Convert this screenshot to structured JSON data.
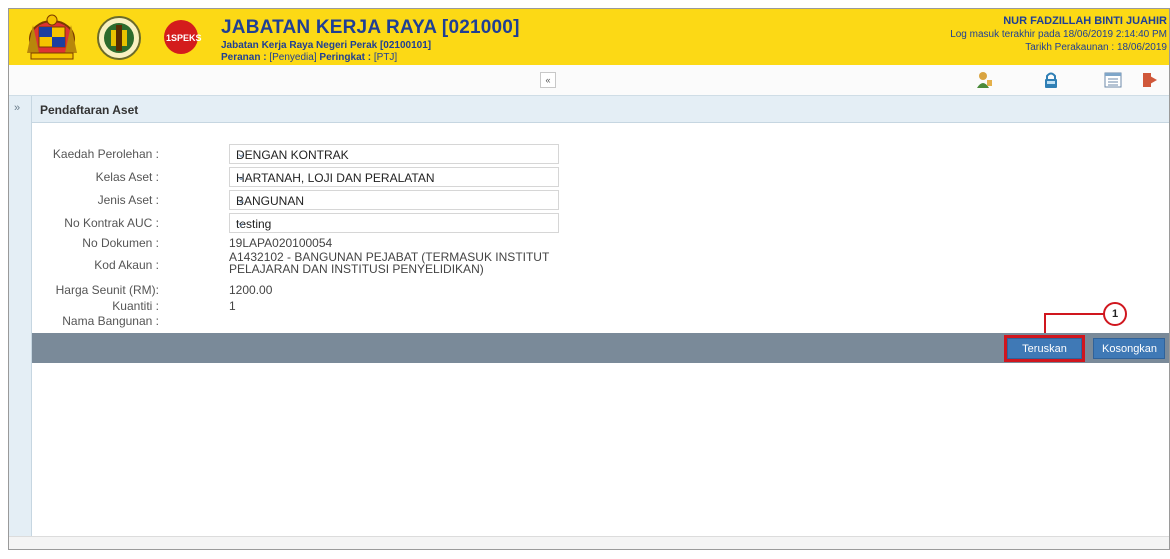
{
  "header": {
    "title": "JABATAN KERJA RAYA [021000]",
    "subtitle": "Jabatan Kerja Raya Negeri Perak [02100101]",
    "role_label": "Peranan :",
    "role_value": "[Penyedia]",
    "level_label": "Peringkat :",
    "level_value": "[PTJ]",
    "logo_text": "1SPEKS",
    "user_name": "NUR FADZILLAH BINTI JUAHIR",
    "last_login": "Log masuk terakhir pada 18/06/2019 2:14:40 PM",
    "accounting_date": "Tarikh Perakaunan : 18/06/2019"
  },
  "toolbar": {
    "collapse_glyph": "«",
    "icons": [
      "user-icon",
      "lock-icon",
      "list-icon",
      "logout-icon"
    ]
  },
  "sidebar": {
    "expand_glyph": "»"
  },
  "panel": {
    "title": "Pendaftaran Aset"
  },
  "form": {
    "kaedah_label": "Kaedah Perolehan :",
    "kaedah_value": "DENGAN KONTRAK",
    "kelas_label": "Kelas Aset :",
    "kelas_value": "HARTANAH, LOJI DAN PERALATAN",
    "jenis_label": "Jenis Aset :",
    "jenis_value": "BANGUNAN",
    "kontrak_label": "No Kontrak AUC :",
    "kontrak_value": "testing",
    "dokumen_label": "No Dokumen :",
    "dokumen_value": "19LAPA020100054",
    "akaun_label": "Kod Akaun :",
    "akaun_line1": "A1432102 - BANGUNAN PEJABAT (TERMASUK INSTITUT",
    "akaun_line2": "PELAJARAN DAN INSTITUSI PENYELIDIKAN)",
    "harga_label": "Harga Seunit (RM):",
    "harga_value": "1200.00",
    "kuantiti_label": "Kuantiti :",
    "kuantiti_value": "1",
    "nama_label": "Nama Bangunan :",
    "nama_value": ""
  },
  "actions": {
    "teruskan_label": "Teruskan",
    "kosongkan_label": "Kosongkan",
    "callout_number": "1"
  },
  "colors": {
    "header_bg": "#fcd915",
    "brand_blue": "#1f3f95",
    "button_blue": "#3f79b6",
    "action_bar": "#7a8a99",
    "highlight_red": "#d0161e"
  }
}
